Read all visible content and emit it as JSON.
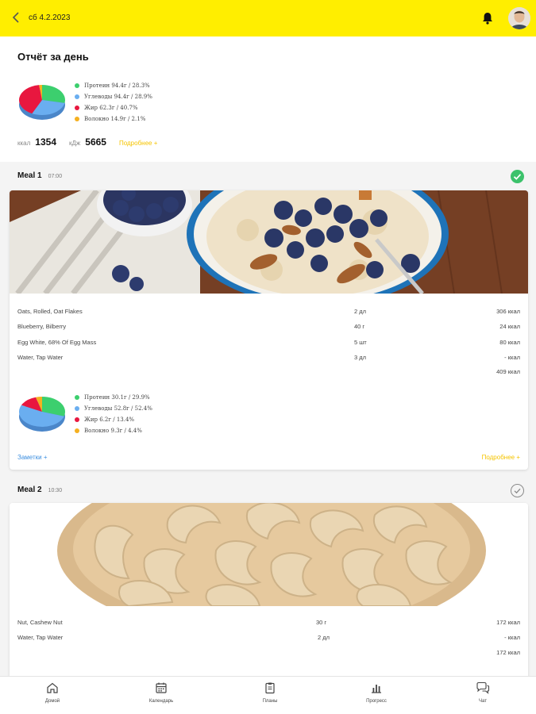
{
  "header": {
    "date": "сб 4.2.2023"
  },
  "report": {
    "title": "Отчёт за день",
    "macros": [
      {
        "label": "Протеин 94.4г / 28.3%",
        "color": "#3ccf6e",
        "share": 28.3
      },
      {
        "label": "Углеводы 94.4г / 28.9%",
        "color": "#6aaef0",
        "share": 28.9
      },
      {
        "label": "Жир 62.3г / 40.7%",
        "color": "#e8173f",
        "share": 40.7
      },
      {
        "label": "Волокно 14.9г / 2.1%",
        "color": "#f5b020",
        "share": 2.1
      }
    ],
    "kcal_label": "ккал",
    "kcal_value": "1354",
    "kj_label": "кДж",
    "kj_value": "5665",
    "details_link": "Подробнее +"
  },
  "meals": [
    {
      "name": "Meal 1",
      "time": "07:00",
      "done": true,
      "photo": "oatmeal with blueberries and almonds",
      "items": [
        {
          "name": "Oats, Rolled, Oat Flakes",
          "qty": "2 дл",
          "kcal": "306 ккал"
        },
        {
          "name": "Blueberry, Bilberry",
          "qty": "40 г",
          "kcal": "24 ккал"
        },
        {
          "name": "Egg White, 68% Of Egg Mass",
          "qty": "5 шт",
          "kcal": "80 ккал"
        },
        {
          "name": "Water, Tap Water",
          "qty": "3 дл",
          "kcal": "- ккал"
        }
      ],
      "total": "409 ккал",
      "macros": [
        {
          "label": "Протеин 30.1г / 29.9%",
          "color": "#3ccf6e",
          "share": 29.9
        },
        {
          "label": "Углеводы 52.8г / 52.4%",
          "color": "#6aaef0",
          "share": 52.4
        },
        {
          "label": "Жир 6.2г / 13.4%",
          "color": "#e8173f",
          "share": 13.4
        },
        {
          "label": "Волокно 9.3г / 4.4%",
          "color": "#f5b020",
          "share": 4.4
        }
      ],
      "notes_link": "Заметки +",
      "details_link": "Подробнее +"
    },
    {
      "name": "Meal 2",
      "time": "10:30",
      "done": false,
      "photo": "bowl of cashew nuts",
      "items": [
        {
          "name": "Nut, Cashew Nut",
          "qty": "30 г",
          "kcal": "172 ккал"
        },
        {
          "name": "Water, Tap Water",
          "qty": "2 дл",
          "kcal": "- ккал"
        }
      ],
      "total": "172 ккал"
    }
  ],
  "tabs": [
    {
      "label": "Домой",
      "icon": "home-icon"
    },
    {
      "label": "Календарь",
      "icon": "calendar-icon"
    },
    {
      "label": "Планы",
      "icon": "clipboard-icon"
    },
    {
      "label": "Прогресс",
      "icon": "bar-chart-icon"
    },
    {
      "label": "Чат",
      "icon": "chat-icon"
    }
  ],
  "colors": {
    "header": "#ffee00",
    "accent": "#f5c400",
    "done": "#3cc26b",
    "link_blue": "#3d8fe0"
  }
}
